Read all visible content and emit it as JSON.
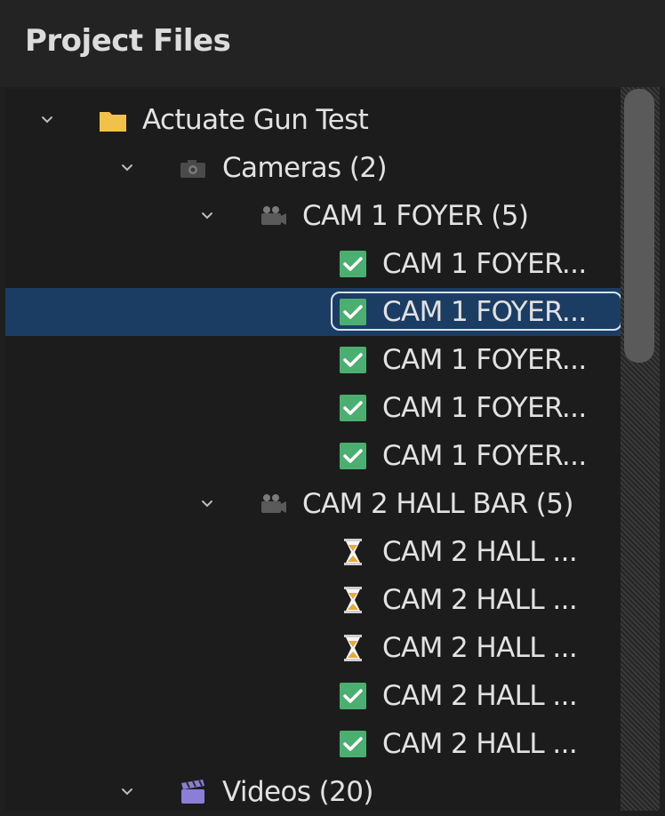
{
  "panel": {
    "title": "Project Files"
  },
  "colors": {
    "selection": "#1c3d63",
    "check": "#4caf72",
    "folder": "#f2c14a",
    "hourglass": "#e9a83a",
    "video_icon": "#8a7ed6"
  },
  "tree": [
    {
      "label": "Actuate Gun Test",
      "icon": "folder-icon",
      "expanded": true,
      "level": 0
    },
    {
      "label": "Cameras (2)",
      "icon": "camera-icon",
      "expanded": true,
      "level": 1
    },
    {
      "label": "CAM 1 FOYER (5)",
      "icon": "video-camera-icon",
      "expanded": true,
      "level": 2
    },
    {
      "label": "CAM 1 FOYER...",
      "icon": "check-icon",
      "level": 3
    },
    {
      "label": "CAM 1 FOYER...",
      "icon": "check-icon",
      "level": 3,
      "selected": true
    },
    {
      "label": "CAM 1 FOYER...",
      "icon": "check-icon",
      "level": 3
    },
    {
      "label": "CAM 1 FOYER...",
      "icon": "check-icon",
      "level": 3
    },
    {
      "label": "CAM 1 FOYER...",
      "icon": "check-icon",
      "level": 3
    },
    {
      "label": "CAM 2 HALL BAR (5)",
      "icon": "video-camera-icon",
      "expanded": true,
      "level": 2
    },
    {
      "label": "CAM 2 HALL ...",
      "icon": "hourglass-icon",
      "level": 3
    },
    {
      "label": "CAM 2 HALL ...",
      "icon": "hourglass-icon",
      "level": 3
    },
    {
      "label": "CAM 2 HALL ...",
      "icon": "hourglass-icon",
      "level": 3
    },
    {
      "label": "CAM 2 HALL ...",
      "icon": "check-icon",
      "level": 3
    },
    {
      "label": "CAM 2 HALL ...",
      "icon": "check-icon",
      "level": 3
    },
    {
      "label": "Videos (20)",
      "icon": "clapperboard-icon",
      "expanded": true,
      "level": 1
    }
  ]
}
